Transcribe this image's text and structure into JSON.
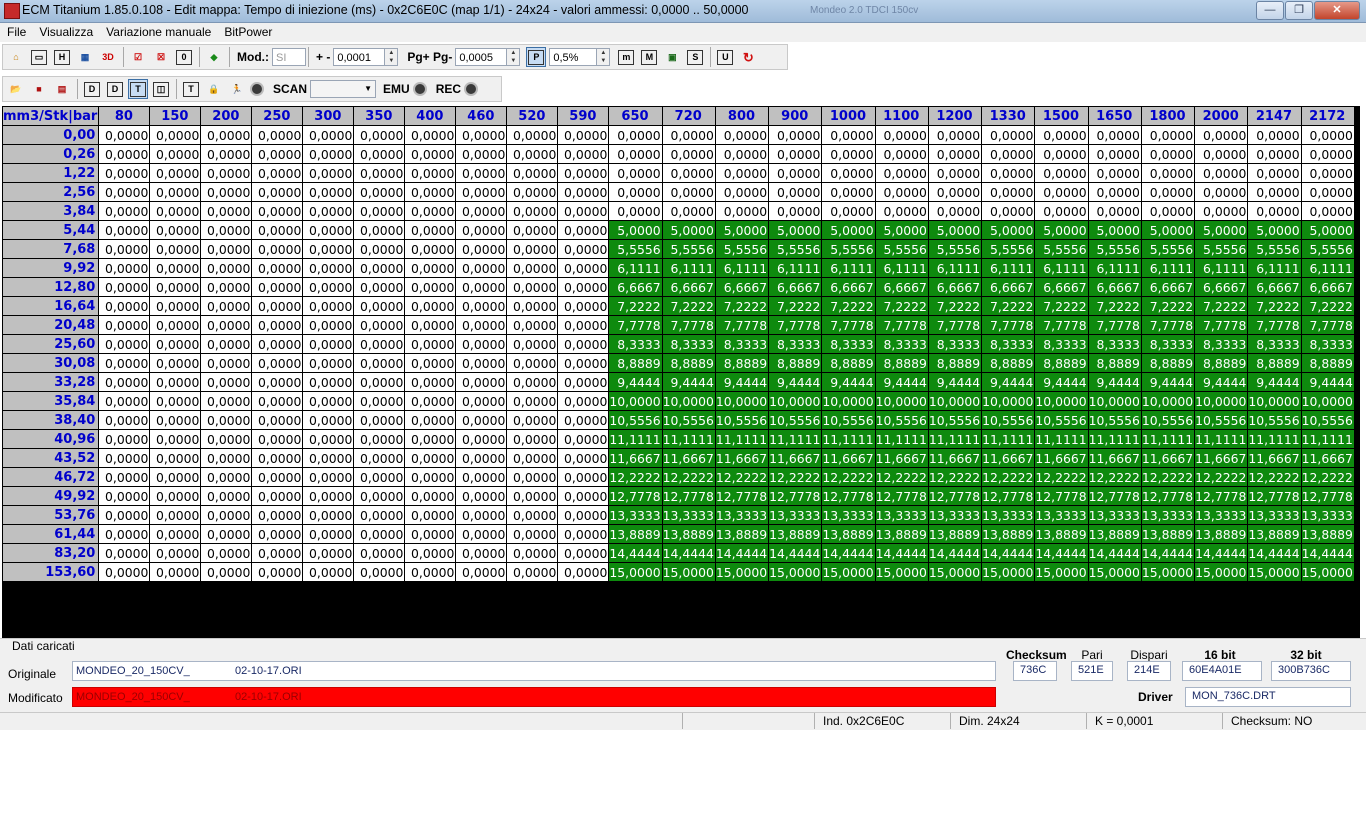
{
  "window": {
    "title": "ECM Titanium 1.85.0.108 - Edit mappa: Tempo di iniezione (ms) - 0x2C6E0C (map 1/1) - 24x24 - valori ammessi: 0,0000 .. 50,0000",
    "background_text": "Mondeo 2.0 TDCI 150cv",
    "minimize": "—",
    "restore": "❐",
    "close": "✕"
  },
  "menu": [
    "File",
    "Visualizza",
    "Variazione manuale",
    "BitPower"
  ],
  "toolbar1": {
    "mod_label": "Mod.:",
    "mod_value": "SI",
    "plusminus_label": "+ -",
    "step_value": "0,0001",
    "pg_label": "Pg+ Pg-",
    "pg_value": "0,0005",
    "percent_value": "0,5%"
  },
  "toolbar2": {
    "scan_label": "SCAN",
    "scan_value": "",
    "emu_label": "EMU",
    "rec_label": "REC"
  },
  "icons": {
    "toolbar1": [
      "home-icon",
      "copy-map-icon",
      "table-h-icon",
      "graph-icon",
      "3d-view-icon",
      "checklist-icon",
      "checklist-x-icon",
      "counter-icon",
      "color-marker-icon"
    ],
    "toolbar1_right": [
      "m-lower-icon",
      "m-upper-icon",
      "image-icon",
      "s-icon",
      "u-icon",
      "refresh-red-icon"
    ],
    "toolbar2": [
      "open-folder-icon",
      "save-red-icon",
      "save-as-icon",
      "d-view-icon",
      "d-alt-icon",
      "t-view-icon",
      "split-view-icon",
      "t-box-icon",
      "lock-icon",
      "runner-icon",
      "radio-icon"
    ]
  },
  "map": {
    "corner": "mm3/Stk|bar",
    "columns": [
      "80",
      "150",
      "200",
      "250",
      "300",
      "350",
      "400",
      "460",
      "520",
      "590",
      "650",
      "720",
      "800",
      "900",
      "1000",
      "1100",
      "1200",
      "1330",
      "1500",
      "1650",
      "1800",
      "2000",
      "2147",
      "2172"
    ],
    "rows": [
      {
        "label": "0,00",
        "first": "0,0000",
        "rest": "0,0000"
      },
      {
        "label": "0,26",
        "first": "0,0000",
        "rest": "0,0000"
      },
      {
        "label": "1,22",
        "first": "0,0000",
        "rest": "0,0000"
      },
      {
        "label": "2,56",
        "first": "0,0000",
        "rest": "0,0000"
      },
      {
        "label": "3,84",
        "first": "0,0000",
        "rest": "0,0000"
      },
      {
        "label": "5,44",
        "first": "0,0000",
        "rest": "5,0000"
      },
      {
        "label": "7,68",
        "first": "0,0000",
        "rest": "5,5556"
      },
      {
        "label": "9,92",
        "first": "0,0000",
        "rest": "6,1111"
      },
      {
        "label": "12,80",
        "first": "0,0000",
        "rest": "6,6667"
      },
      {
        "label": "16,64",
        "first": "0,0000",
        "rest": "7,2222"
      },
      {
        "label": "20,48",
        "first": "0,0000",
        "rest": "7,7778"
      },
      {
        "label": "25,60",
        "first": "0,0000",
        "rest": "8,3333"
      },
      {
        "label": "30,08",
        "first": "0,0000",
        "rest": "8,8889"
      },
      {
        "label": "33,28",
        "first": "0,0000",
        "rest": "9,4444"
      },
      {
        "label": "35,84",
        "first": "0,0000",
        "rest": "10,0000"
      },
      {
        "label": "38,40",
        "first": "0,0000",
        "rest": "10,5556"
      },
      {
        "label": "40,96",
        "first": "0,0000",
        "rest": "11,1111"
      },
      {
        "label": "43,52",
        "first": "0,0000",
        "rest": "11,6667"
      },
      {
        "label": "46,72",
        "first": "0,0000",
        "rest": "12,2222"
      },
      {
        "label": "49,92",
        "first": "0,0000",
        "rest": "12,7778"
      },
      {
        "label": "53,76",
        "first": "0,0000",
        "rest": "13,3333"
      },
      {
        "label": "61,44",
        "first": "0,0000",
        "rest": "13,8889"
      },
      {
        "label": "83,20",
        "first": "0,0000",
        "rest": "14,4444"
      },
      {
        "label": "153,60",
        "first": "0,0000",
        "rest": "15,0000"
      }
    ],
    "modified_start_column": 10,
    "modified_start_row": 5,
    "colors": {
      "modified": "#0e8a0e",
      "normal": "#ffffff",
      "header": "#c0c0c0",
      "header_text": "#0000cc"
    }
  },
  "info": {
    "section_label": "Dati caricati",
    "originale_label": "Originale",
    "originale_name": "MONDEO_20_150CV_",
    "originale_date": "02-10-17.ORI",
    "modificato_label": "Modificato",
    "modificato_name": "MONDEO_20_150CV_",
    "modificato_date": "02-10-17.ORI",
    "checksum_label": "Checksum",
    "pari_label": "Pari",
    "dispari_label": "Dispari",
    "bit16_label": "16 bit",
    "bit32_label": "32 bit",
    "checksum_value": "736C",
    "pari_value": "521E",
    "dispari_value": "214E",
    "bit16_value": "60E4A01E",
    "bit32_value": "300B736C",
    "driver_label": "Driver",
    "driver_value": "MON_736C.DRT"
  },
  "status": {
    "ind": "Ind. 0x2C6E0C",
    "dim": "Dim. 24x24",
    "k": "K = 0,0001",
    "checksum": "Checksum: NO"
  }
}
